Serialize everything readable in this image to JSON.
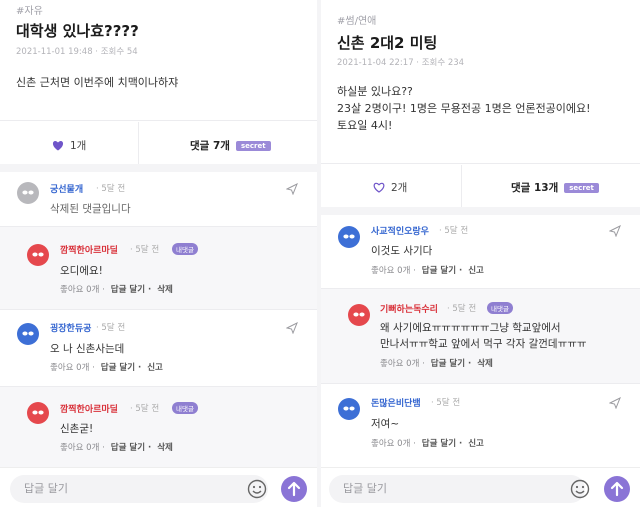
{
  "left": {
    "category": "#자유",
    "title": "대학생 있나효????",
    "meta": "2021-11-01 19:48 · 조회수 54",
    "body": [
      "신촌 근처면 이번주에 치맥이나하쟈"
    ],
    "likes": "1개",
    "comments_label": "댓글 7개",
    "secret_badge": "secret",
    "comment_list": [
      {
        "nick": "궁선물개",
        "ago": "· 5달 전",
        "text": "삭제된 댓글입니다",
        "actions": "",
        "reply": false,
        "writer": false
      },
      {
        "nick": "깜찍한아르마딜",
        "ago": "· 5달 전",
        "text": "오디에요!",
        "like": "좋아요 0개 ·",
        "reply_label": "답글 달기 ·",
        "extra": "삭제",
        "reply": true,
        "writer": true,
        "writer_tag": "내댓글"
      },
      {
        "nick": "굉장한듀공",
        "ago": "· 5달 전",
        "text": "오 나 신촌사는데",
        "like": "좋아요 0개 ·",
        "reply_label": "답글 달기 ·",
        "extra": "신고",
        "reply": false,
        "writer": false
      },
      {
        "nick": "깜찍한아르마딜",
        "ago": "· 5달 전",
        "text": "신촌굳!",
        "like": "좋아요 0개 ·",
        "reply_label": "답글 달기 ·",
        "extra": "삭제",
        "reply": true,
        "writer": true,
        "writer_tag": "내댓글"
      }
    ],
    "input_placeholder": "답글 달기"
  },
  "right": {
    "category": "#썸/연애",
    "title": "신촌 2대2 미팅",
    "meta": "2021-11-04 22:17 · 조회수 234",
    "body": [
      "하실분 있나요??",
      "23살 2명이구! 1명은 무용전공 1명은 언론전공이에요!",
      "토요일 4시!"
    ],
    "likes": "2개",
    "comments_label": "댓글 13개",
    "secret_badge": "secret",
    "comment_list": [
      {
        "nick": "사교적인오랑우",
        "ago": "· 5달 전",
        "text": "이것도 사기다",
        "like": "좋아요 0개 ·",
        "reply_label": "답글 달기 ·",
        "extra": "신고",
        "reply": false,
        "writer": false
      },
      {
        "nick": "기뻐하는독수리",
        "ago": "· 5달 전",
        "text": "왜 사기에요ㅠㅠㅠㅠㅠㅠ그냥 학교앞에서",
        "text2": "만나서ㅠㅠ학교 앞에서 먹구 각자 갈껀데ㅠㅠㅠ",
        "like": "좋아요 0개 ·",
        "reply_label": "답글 달기 ·",
        "extra": "삭제",
        "reply": true,
        "writer": true,
        "writer_tag": "내댓글"
      },
      {
        "nick": "돈많은비단뱀",
        "ago": "· 5달 전",
        "text": "저여~",
        "like": "좋아요 0개 ·",
        "reply_label": "답글 달기 ·",
        "extra": "신고",
        "reply": false,
        "writer": false
      }
    ],
    "input_placeholder": "답글 달기"
  },
  "colors": {
    "accent": "#8a74d6",
    "avatar_grey": "#b8b8bc",
    "avatar_red": "#e5484d",
    "avatar_blue": "#3d6fd6",
    "nick_red": "#d9313a",
    "nick_blue": "#3566d0"
  }
}
